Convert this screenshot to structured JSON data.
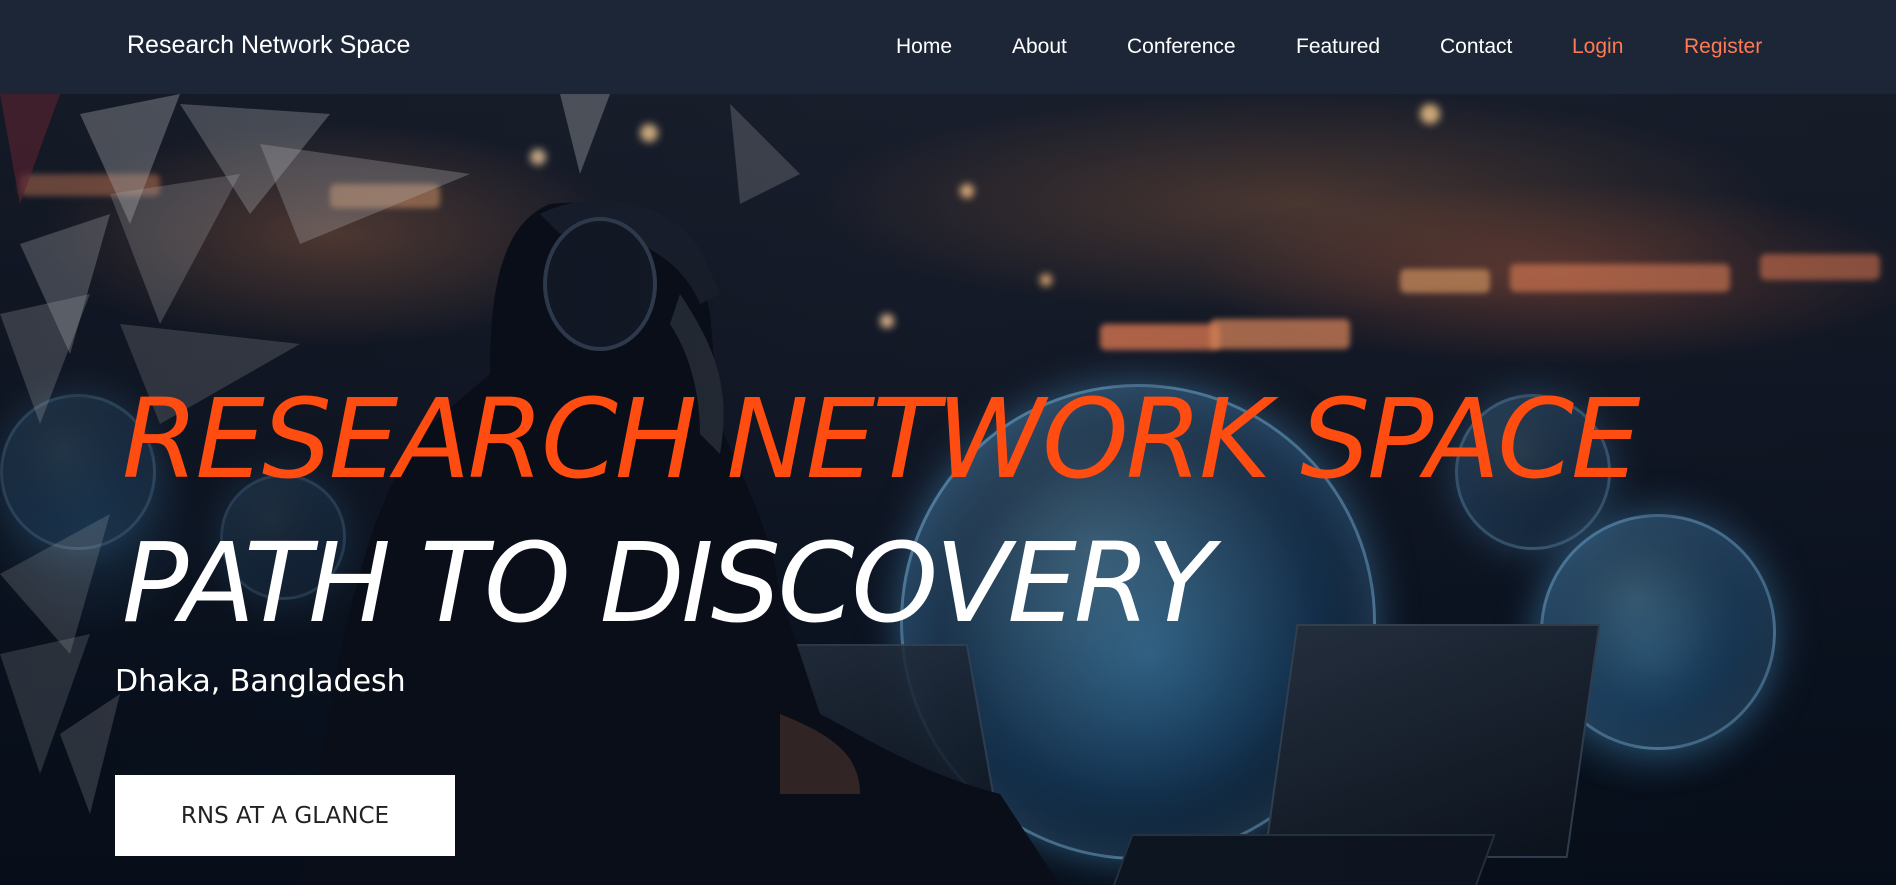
{
  "navbar": {
    "brand": "Research Network Space",
    "links": [
      "Home",
      "About",
      "Conference",
      "Featured",
      "Contact"
    ],
    "login": "Login",
    "register": "Register",
    "accent_color": "#ff7a52",
    "background_color": "#1c2636"
  },
  "hero": {
    "title_line1": "RESEARCH NETWORK SPACE",
    "title_line2": "PATH TO DISCOVERY",
    "location": "Dhaka, Bangladesh",
    "cta_label": "RNS AT A GLANCE",
    "title_color": "#ff4d12"
  }
}
